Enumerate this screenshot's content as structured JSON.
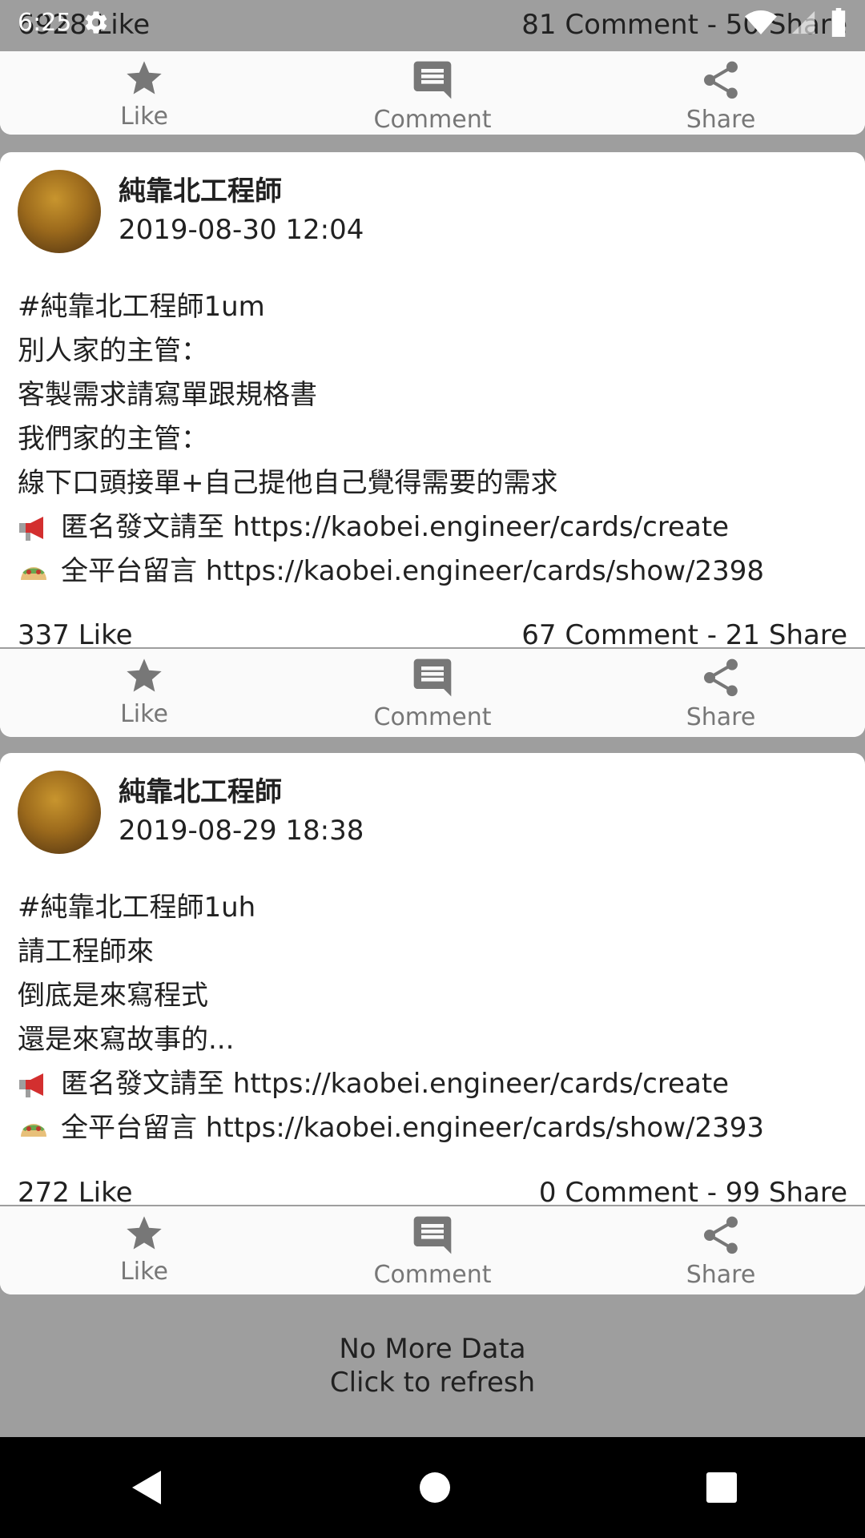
{
  "status_bar": {
    "time": "6:25",
    "icons": [
      "settings-gear-icon",
      "wifi-icon",
      "signal-icon",
      "battery-icon"
    ]
  },
  "top_partial_post": {
    "likes": "6928 Like",
    "comments_shares": "81 Comment - 50 Share",
    "actions": [
      "Like",
      "Comment",
      "Share"
    ]
  },
  "posts": [
    {
      "author": "純靠北工程師",
      "time": "2019-08-30 12:04",
      "lines": [
        "#純靠北工程師1um",
        "別人家的主管：",
        "客製需求請寫單跟規格書",
        "我們家的主管：",
        "線下口頭接單+自己提他自己覺得需要的需求"
      ],
      "post_link_text": "匿名發文請至 https://kaobei.engineer/cards/create",
      "comment_link_text": "全平台留言 https://kaobei.engineer/cards/show/2398",
      "likes": "337 Like",
      "comments_shares": "67 Comment - 21 Share",
      "actions": [
        "Like",
        "Comment",
        "Share"
      ]
    },
    {
      "author": "純靠北工程師",
      "time": "2019-08-29 18:38",
      "lines": [
        "#純靠北工程師1uh",
        "請工程師來",
        "倒底是來寫程式",
        "還是來寫故事的..."
      ],
      "post_link_text": "匿名發文請至 https://kaobei.engineer/cards/create",
      "comment_link_text": "全平台留言 https://kaobei.engineer/cards/show/2393",
      "likes": "272 Like",
      "comments_shares": "0 Comment - 99 Share",
      "actions": [
        "Like",
        "Comment",
        "Share"
      ]
    }
  ],
  "footer": {
    "line1": "No More Data",
    "line2": "Click to refresh"
  },
  "nav_bar": {
    "icons": [
      "back-triangle-icon",
      "home-circle-icon",
      "recents-square-icon"
    ]
  },
  "colors": {
    "background": "#9e9e9e",
    "card": "#ffffff",
    "action_gray": "#777777",
    "text": "#212121"
  }
}
